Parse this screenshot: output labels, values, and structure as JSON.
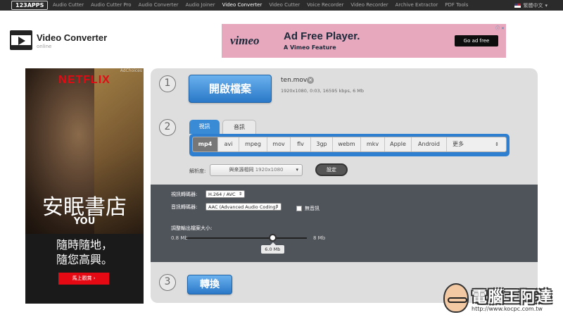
{
  "topbar": {
    "brand": "123APPS",
    "nav": [
      "Audio Cutter",
      "Audio Cutter Pro",
      "Audio Converter",
      "Audio Joiner",
      "Video Converter",
      "Video Cutter",
      "Voice Recorder",
      "Video Recorder",
      "Archive Extractor",
      "PDF Tools"
    ],
    "active_nav": "Video Converter",
    "language": "繁體中文"
  },
  "app": {
    "title": "Video Converter",
    "status": "online",
    "icon": "film-play-icon"
  },
  "ads": {
    "vimeo": {
      "logo": "vimeo",
      "headline": "Ad Free Player.",
      "subline": "A Vimeo Feature",
      "cta": "Go ad free",
      "bg_color": "#e7a8bd"
    },
    "netflix": {
      "logo": "NETFLIX",
      "adchoice": "AdChoices",
      "title_cn": "安眠書店",
      "title_en": "YOU",
      "tagline_1": "隨時隨地，",
      "tagline_2": "隨您高興。",
      "cta": "馬上觀賞 ›"
    }
  },
  "steps": {
    "step1": {
      "number": "1",
      "open_button": "開啟檔案",
      "file_name": "ten.mov",
      "file_meta": "1920x1080, 0:03, 16595 kbps, 6 Mb"
    },
    "step2": {
      "number": "2",
      "tabs": [
        "視訊",
        "音訊"
      ],
      "active_tab": "視訊",
      "formats": [
        "mp4",
        "avi",
        "mpeg",
        "mov",
        "flv",
        "3gp",
        "webm",
        "mkv",
        "Apple",
        "Android",
        "更多"
      ],
      "active_format": "mp4",
      "resolution_label": "解析度:",
      "resolution_value": "與來源相同",
      "resolution_dim": "1920x1080",
      "settings_button": "設定",
      "video_codec_label": "視訊轉碼器:",
      "video_codec": "H.264 / AVC",
      "audio_codec_label": "音訊轉碼器:",
      "audio_codec": "AAC (Advanced Audio Coding)",
      "no_audio_label": "無音訊",
      "no_audio_checked": false,
      "size_label": "調整輸出檔案大小:",
      "size_min": "0.8 Mb",
      "size_max": "8 Mb",
      "size_value": "6.0 Mb",
      "size_fraction": 0.72
    },
    "step3": {
      "number": "3",
      "convert_button": "轉換"
    }
  },
  "watermark": {
    "title": "電腦王阿達",
    "url": "http://www.kocpc.com.tw"
  }
}
